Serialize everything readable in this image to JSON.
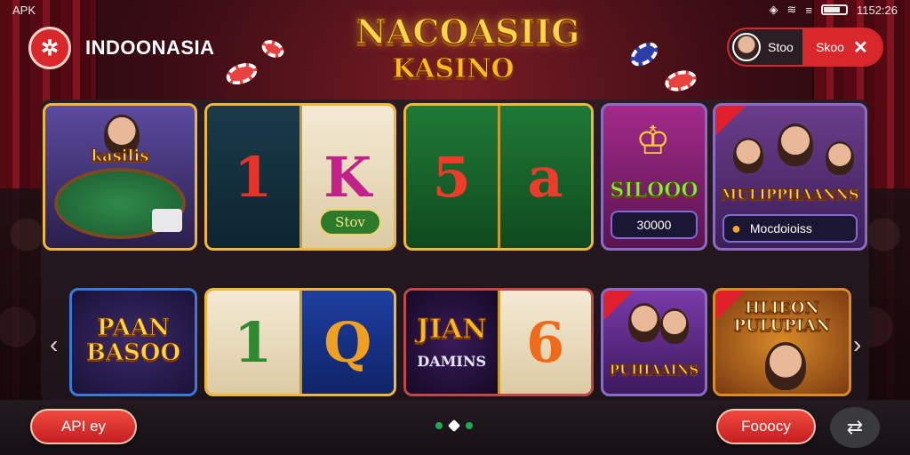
{
  "status_bar": {
    "left_label": "APK",
    "time": "1152:26"
  },
  "header": {
    "brand_name": "INDOONASIA",
    "logo_line1": "NACOASIIG",
    "logo_line2": "KASINO"
  },
  "user": {
    "name": "Stoo",
    "stop_label": "Skoo",
    "close_icon": "✕"
  },
  "games_row1": [
    {
      "title": "kasilis"
    },
    {
      "symbols": [
        "1",
        "K"
      ],
      "badge": "Stov"
    },
    {
      "symbols": [
        "5",
        "a"
      ]
    },
    {
      "title": "SILOOO",
      "value": "30000"
    },
    {
      "title": "MULIPPHAANNS",
      "subtitle": "Mocdoioiss"
    }
  ],
  "games_row2": [
    {
      "title": "PAAN BASOO"
    },
    {
      "symbols": [
        "1",
        "Q"
      ]
    },
    {
      "title": "JIAN",
      "subtitle": "DAMINS",
      "symbol": "6"
    },
    {
      "title": "PUHIAAINS"
    },
    {
      "title": "HLIEON PULUPIAN"
    }
  ],
  "nav": {
    "prev_icon": "‹",
    "next_icon": "›"
  },
  "footer": {
    "left_button": "API ey",
    "right_button": "Fooocy",
    "pager_dots": 3,
    "pager_active": 2
  },
  "colors": {
    "accent_red": "#d9282b",
    "gold": "#f0b73a",
    "pager_green": "#1fa85a"
  }
}
